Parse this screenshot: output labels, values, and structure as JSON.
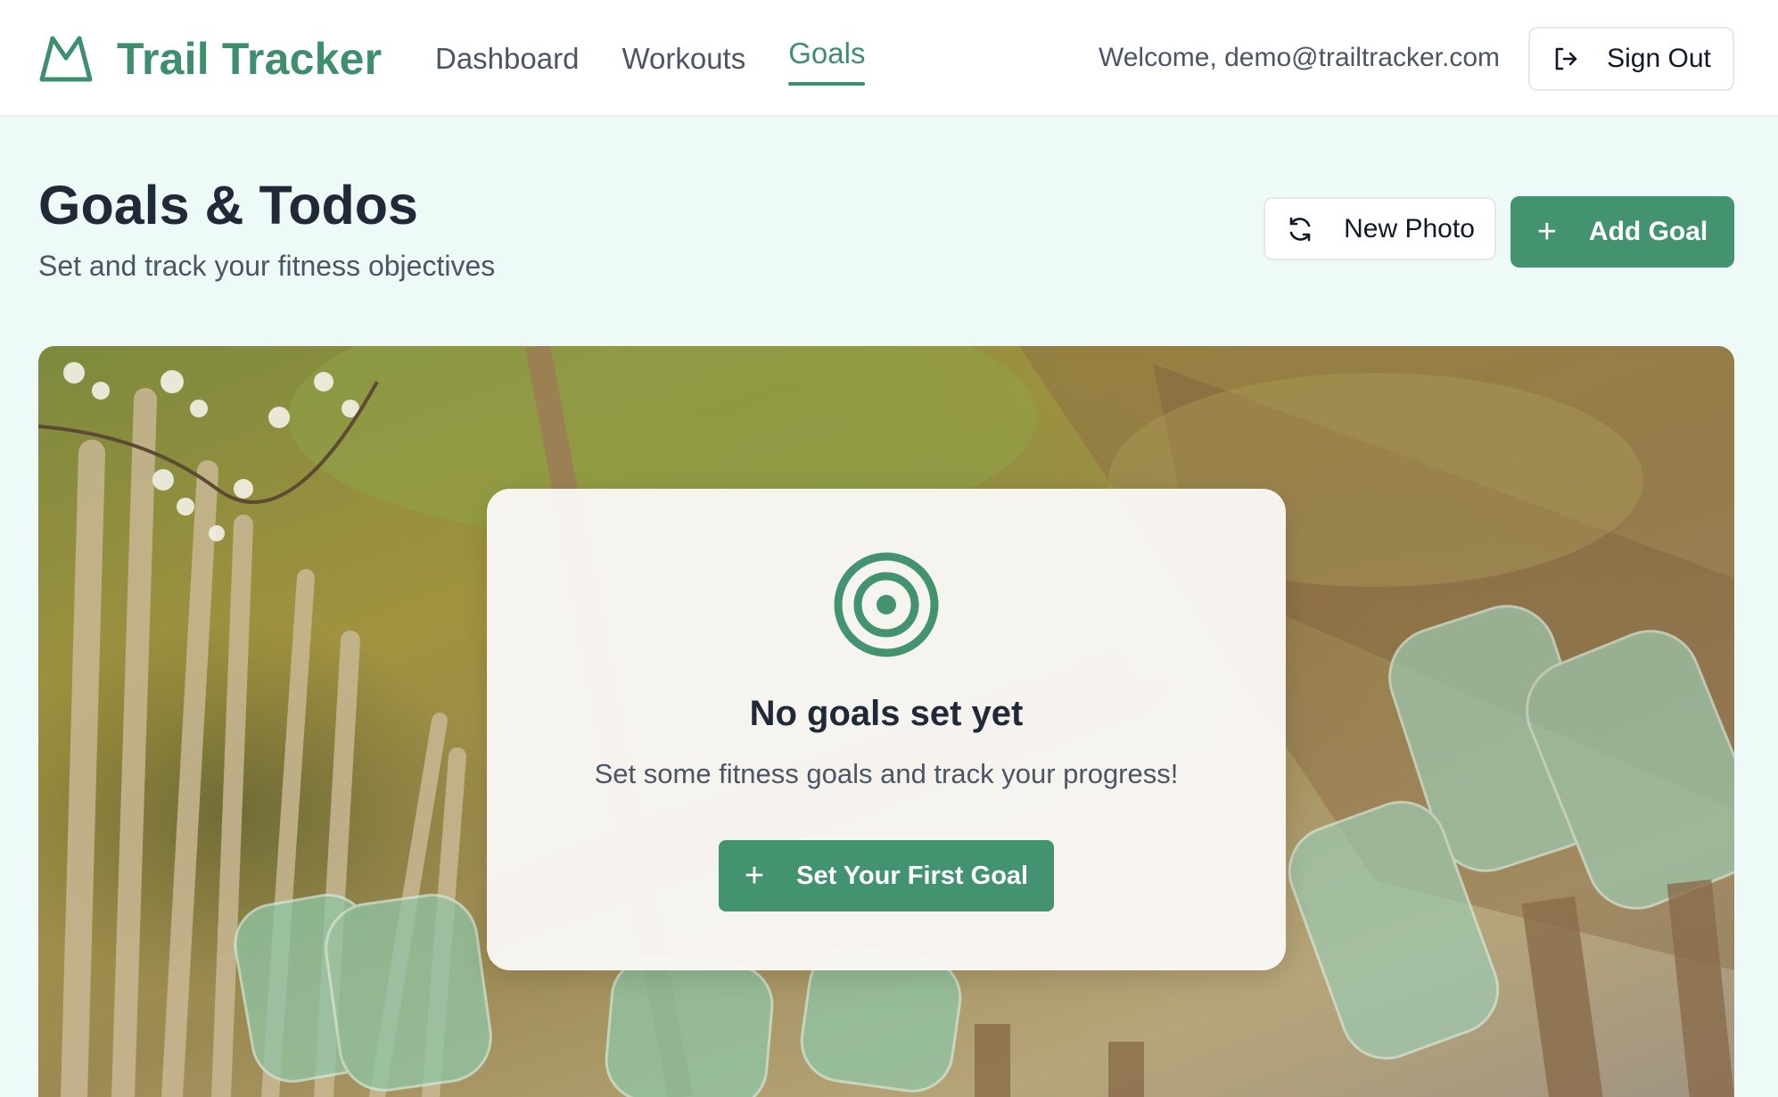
{
  "app": {
    "name": "Trail Tracker",
    "logo_icon": "mountain-icon"
  },
  "nav": {
    "items": [
      {
        "label": "Dashboard",
        "active": false
      },
      {
        "label": "Workouts",
        "active": false
      },
      {
        "label": "Goals",
        "active": true
      }
    ]
  },
  "header": {
    "welcome": "Welcome, demo@trailtracker.com",
    "sign_out_label": "Sign Out",
    "sign_out_icon": "log-out-icon"
  },
  "page": {
    "title": "Goals & Todos",
    "subtitle": "Set and track your fitness objectives",
    "new_photo_label": "New Photo",
    "new_photo_icon": "refresh-icon",
    "add_goal_label": "Add Goal",
    "add_goal_icon": "plus-icon"
  },
  "empty_state": {
    "icon": "target-icon",
    "title": "No goals set yet",
    "message": "Set some fitness goals and track your progress!",
    "cta_label": "Set Your First Goal",
    "cta_icon": "plus-icon"
  },
  "colors": {
    "accent": "#449370",
    "brand": "#3d8f6d",
    "page_bg": "#eefaf7"
  }
}
